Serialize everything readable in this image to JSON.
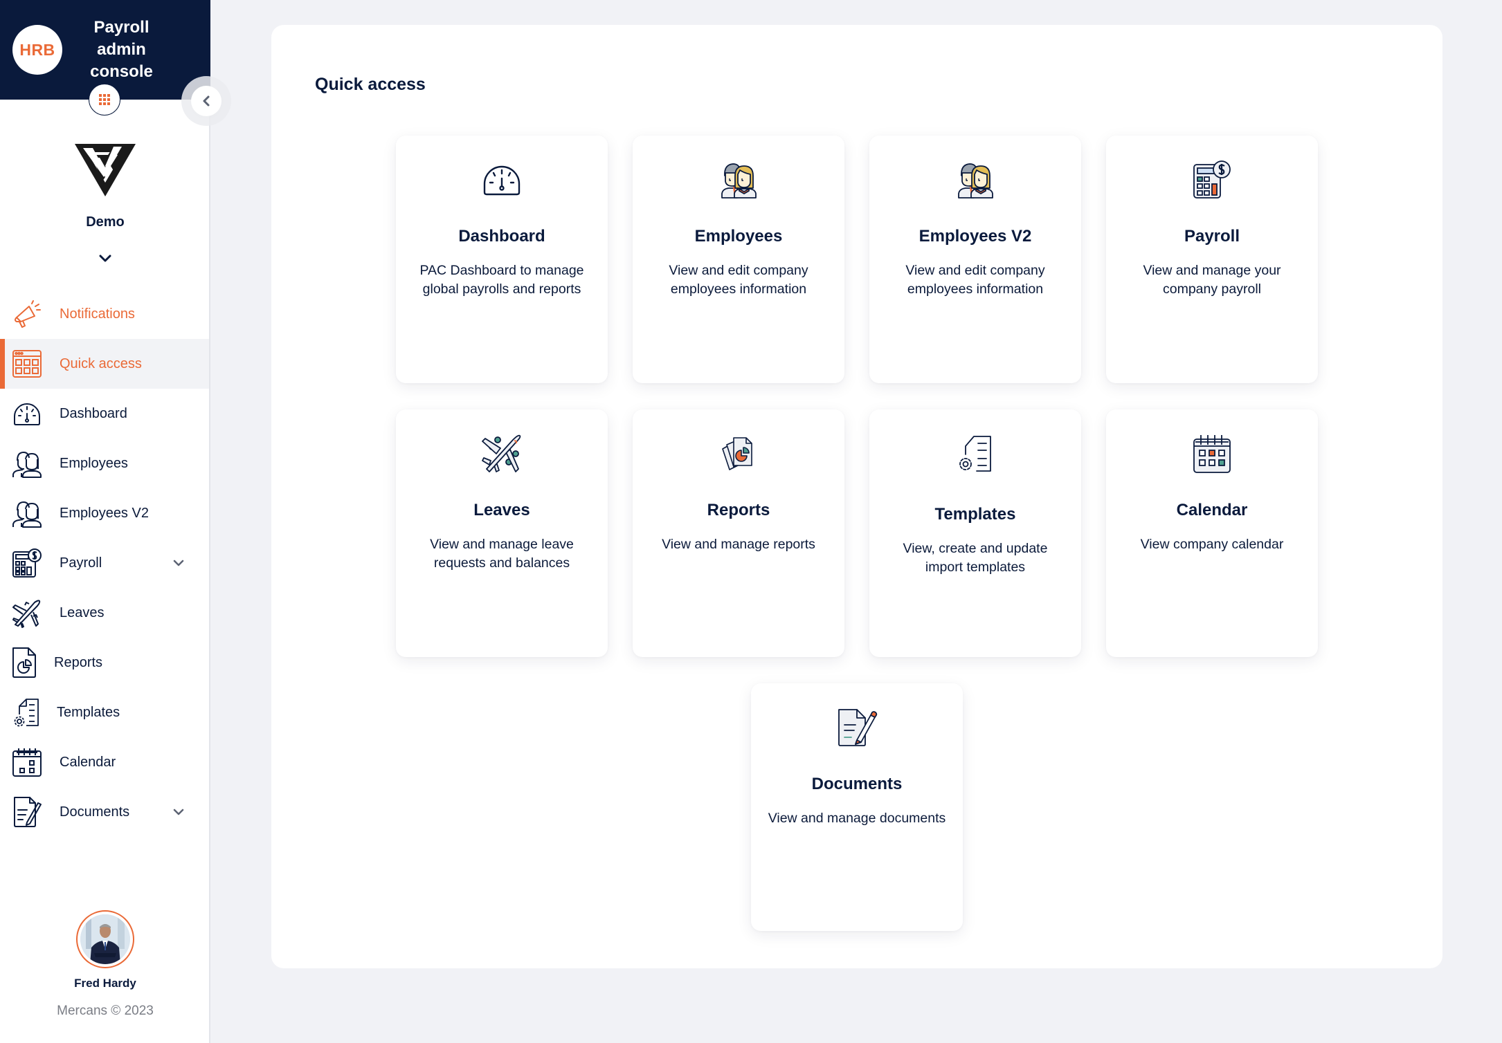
{
  "brand": {
    "logo_text": "HRB",
    "title": "Payroll admin console",
    "apps_button": "apps-grid",
    "collapse_button": "collapse-sidebar"
  },
  "company": {
    "name": "Demo"
  },
  "sidebar": {
    "items": [
      {
        "label": "Notifications",
        "icon": "megaphone-icon",
        "state": "highlight"
      },
      {
        "label": "Quick access",
        "icon": "quick-access-grid-icon",
        "state": "active"
      },
      {
        "label": "Dashboard",
        "icon": "gauge-icon"
      },
      {
        "label": "Employees",
        "icon": "employees-icon"
      },
      {
        "label": "Employees V2",
        "icon": "employees-icon"
      },
      {
        "label": "Payroll",
        "icon": "calculator-dollar-icon",
        "expandable": true
      },
      {
        "label": "Leaves",
        "icon": "airplane-icon"
      },
      {
        "label": "Reports",
        "icon": "report-pie-icon"
      },
      {
        "label": "Templates",
        "icon": "template-gear-icon"
      },
      {
        "label": "Calendar",
        "icon": "calendar-icon"
      },
      {
        "label": "Documents",
        "icon": "document-edit-icon",
        "expandable": true
      }
    ]
  },
  "user": {
    "name": "Fred Hardy",
    "copyright": "Mercans © 2023"
  },
  "main": {
    "title": "Quick access",
    "cards": [
      {
        "title": "Dashboard",
        "description": "PAC Dashboard to manage global payrolls and reports",
        "icon": "gauge-icon"
      },
      {
        "title": "Employees",
        "description": "View and edit company employees information",
        "icon": "employees-icon"
      },
      {
        "title": "Employees V2",
        "description": "View and edit company employees information",
        "icon": "employees-icon"
      },
      {
        "title": "Payroll",
        "description": "View and manage your company payroll",
        "icon": "calculator-dollar-icon"
      },
      {
        "title": "Leaves",
        "description": "View and manage leave requests and balances",
        "icon": "airplane-icon"
      },
      {
        "title": "Reports",
        "description": "View and manage reports",
        "icon": "report-pie-icon"
      },
      {
        "title": "Templates",
        "description": "View, create and update import templates",
        "icon": "template-gear-icon"
      },
      {
        "title": "Calendar",
        "description": "View company calendar",
        "icon": "calendar-icon"
      },
      {
        "title": "Documents",
        "description": "View and manage documents",
        "icon": "document-edit-icon"
      }
    ]
  },
  "colors": {
    "navy": "#0a1a3c",
    "accent": "#ea6a37",
    "teal": "#4f9f8f",
    "background": "#f1f2f6",
    "active_row": "#f2f3f6"
  }
}
